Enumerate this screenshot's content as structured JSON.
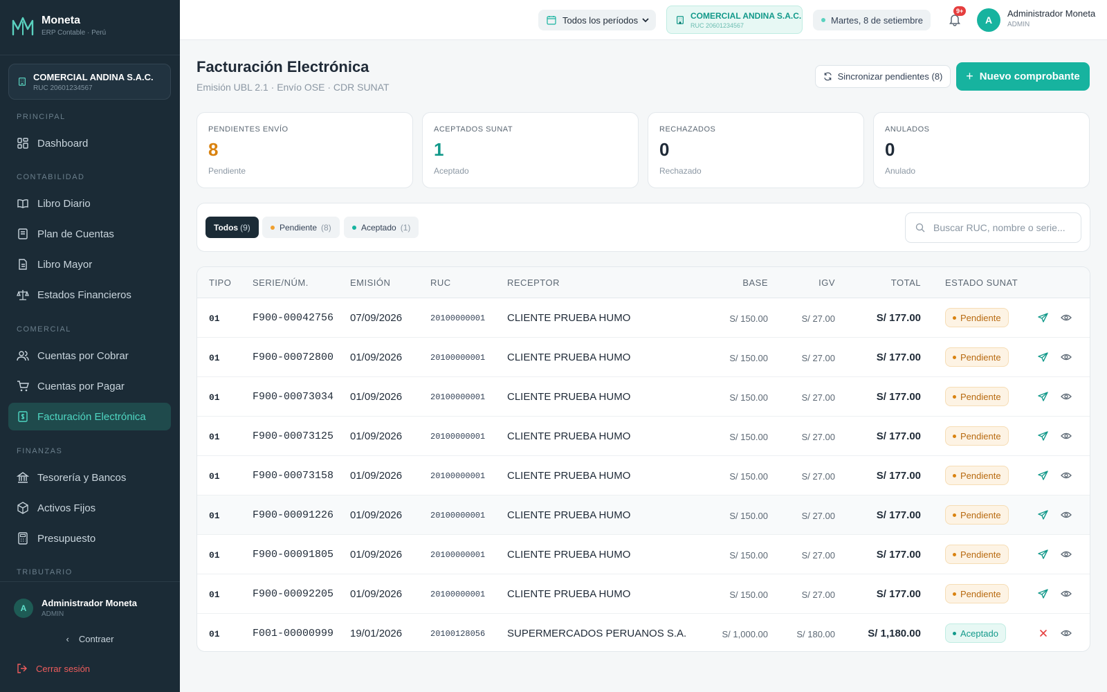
{
  "brand": {
    "name": "Moneta",
    "subtitle": "ERP Contable · Perú"
  },
  "sidebar": {
    "company": {
      "name": "COMERCIAL ANDINA S.A.C.",
      "ruc": "RUC 20601234567"
    },
    "sections": {
      "principal": "PRINCIPAL",
      "contabilidad": "CONTABILIDAD",
      "comercial": "COMERCIAL",
      "finanzas": "FINANZAS",
      "tributario": "TRIBUTARIO"
    },
    "items": {
      "dashboard": "Dashboard",
      "libro_diario": "Libro Diario",
      "plan_cuentas": "Plan de Cuentas",
      "libro_mayor": "Libro Mayor",
      "estados_financieros": "Estados Financieros",
      "cuentas_cobrar": "Cuentas por Cobrar",
      "cuentas_pagar": "Cuentas por Pagar",
      "facturacion": "Facturación Electrónica",
      "tesoreria": "Tesorería y Bancos",
      "activos": "Activos Fijos",
      "presupuesto": "Presupuesto"
    },
    "active_item": "facturacion",
    "user": {
      "initial": "A",
      "name": "Administrador Moneta",
      "role": "ADMIN"
    },
    "collapse": "Contraer",
    "logout": "Cerrar sesión"
  },
  "topbar": {
    "period": "Todos los períodos",
    "company": {
      "name": "COMERCIAL ANDINA S.A.C.",
      "ruc": "RUC 20601234567"
    },
    "date": "Martes, 8 de setiembre",
    "notifications_badge": "9+",
    "user": {
      "initial": "A",
      "name": "Administrador Moneta",
      "role": "ADMIN"
    }
  },
  "header": {
    "title": "Facturación Electrónica",
    "subtitle": "Emisión UBL 2.1 · Envío OSE · CDR SUNAT",
    "sync_button": "Sincronizar pendientes (8)",
    "new_button": "Nuevo comprobante"
  },
  "kpis": [
    {
      "label": "PENDIENTES ENVÍO",
      "value": "8",
      "status": "Pendiente",
      "color": "#d9820f"
    },
    {
      "label": "ACEPTADOS SUNAT",
      "value": "1",
      "status": "Aceptado",
      "color": "#12998a"
    },
    {
      "label": "RECHAZADOS",
      "value": "0",
      "status": "Rechazado",
      "color": "#1f2a37"
    },
    {
      "label": "ANULADOS",
      "value": "0",
      "status": "Anulado",
      "color": "#1f2a37"
    }
  ],
  "filters": {
    "chips": [
      {
        "label": "Todos",
        "count": "(9)"
      },
      {
        "label": "Pendiente",
        "count": "(8)"
      },
      {
        "label": "Aceptado",
        "count": "(1)"
      }
    ],
    "search_placeholder": "Buscar RUC, nombre o serie..."
  },
  "table": {
    "headers": {
      "tipo": "TIPO",
      "serie": "SERIE/NÚM.",
      "emision": "EMISIÓN",
      "ruc": "RUC",
      "receptor": "RECEPTOR",
      "base": "BASE",
      "igv": "IGV",
      "total": "TOTAL",
      "estado": "ESTADO SUNAT"
    },
    "rows": [
      {
        "tipo": "01",
        "serie": "F900-00042756",
        "emision": "07/09/2026",
        "ruc": "20100000001",
        "receptor": "CLIENTE PRUEBA HUMO",
        "base": "S/ 150.00",
        "igv": "S/ 27.00",
        "total": "S/ 177.00",
        "estado": "Pendiente",
        "action": "send-icon"
      },
      {
        "tipo": "01",
        "serie": "F900-00072800",
        "emision": "01/09/2026",
        "ruc": "20100000001",
        "receptor": "CLIENTE PRUEBA HUMO",
        "base": "S/ 150.00",
        "igv": "S/ 27.00",
        "total": "S/ 177.00",
        "estado": "Pendiente",
        "action": "send-icon"
      },
      {
        "tipo": "01",
        "serie": "F900-00073034",
        "emision": "01/09/2026",
        "ruc": "20100000001",
        "receptor": "CLIENTE PRUEBA HUMO",
        "base": "S/ 150.00",
        "igv": "S/ 27.00",
        "total": "S/ 177.00",
        "estado": "Pendiente",
        "action": "send-icon"
      },
      {
        "tipo": "01",
        "serie": "F900-00073125",
        "emision": "01/09/2026",
        "ruc": "20100000001",
        "receptor": "CLIENTE PRUEBA HUMO",
        "base": "S/ 150.00",
        "igv": "S/ 27.00",
        "total": "S/ 177.00",
        "estado": "Pendiente",
        "action": "send-icon"
      },
      {
        "tipo": "01",
        "serie": "F900-00073158",
        "emision": "01/09/2026",
        "ruc": "20100000001",
        "receptor": "CLIENTE PRUEBA HUMO",
        "base": "S/ 150.00",
        "igv": "S/ 27.00",
        "total": "S/ 177.00",
        "estado": "Pendiente",
        "action": "send-icon"
      },
      {
        "tipo": "01",
        "serie": "F900-00091226",
        "emision": "01/09/2026",
        "ruc": "20100000001",
        "receptor": "CLIENTE PRUEBA HUMO",
        "base": "S/ 150.00",
        "igv": "S/ 27.00",
        "total": "S/ 177.00",
        "estado": "Pendiente",
        "action": "send-icon"
      },
      {
        "tipo": "01",
        "serie": "F900-00091805",
        "emision": "01/09/2026",
        "ruc": "20100000001",
        "receptor": "CLIENTE PRUEBA HUMO",
        "base": "S/ 150.00",
        "igv": "S/ 27.00",
        "total": "S/ 177.00",
        "estado": "Pendiente",
        "action": "send-icon"
      },
      {
        "tipo": "01",
        "serie": "F900-00092205",
        "emision": "01/09/2026",
        "ruc": "20100000001",
        "receptor": "CLIENTE PRUEBA HUMO",
        "base": "S/ 150.00",
        "igv": "S/ 27.00",
        "total": "S/ 177.00",
        "estado": "Pendiente",
        "action": "send-icon"
      },
      {
        "tipo": "01",
        "serie": "F001-00000999",
        "emision": "19/01/2026",
        "ruc": "20100128056",
        "receptor": "SUPERMERCADOS PERUANOS S.A.",
        "base": "S/ 1,000.00",
        "igv": "S/ 180.00",
        "total": "S/ 1,180.00",
        "estado": "Aceptado",
        "action": "close-icon"
      }
    ]
  },
  "colors": {
    "accent": "#17b39f",
    "sidebar_bg": "#1b2b36",
    "pending": "#d9820f",
    "accepted": "#12998a",
    "danger": "#e53e3e"
  }
}
